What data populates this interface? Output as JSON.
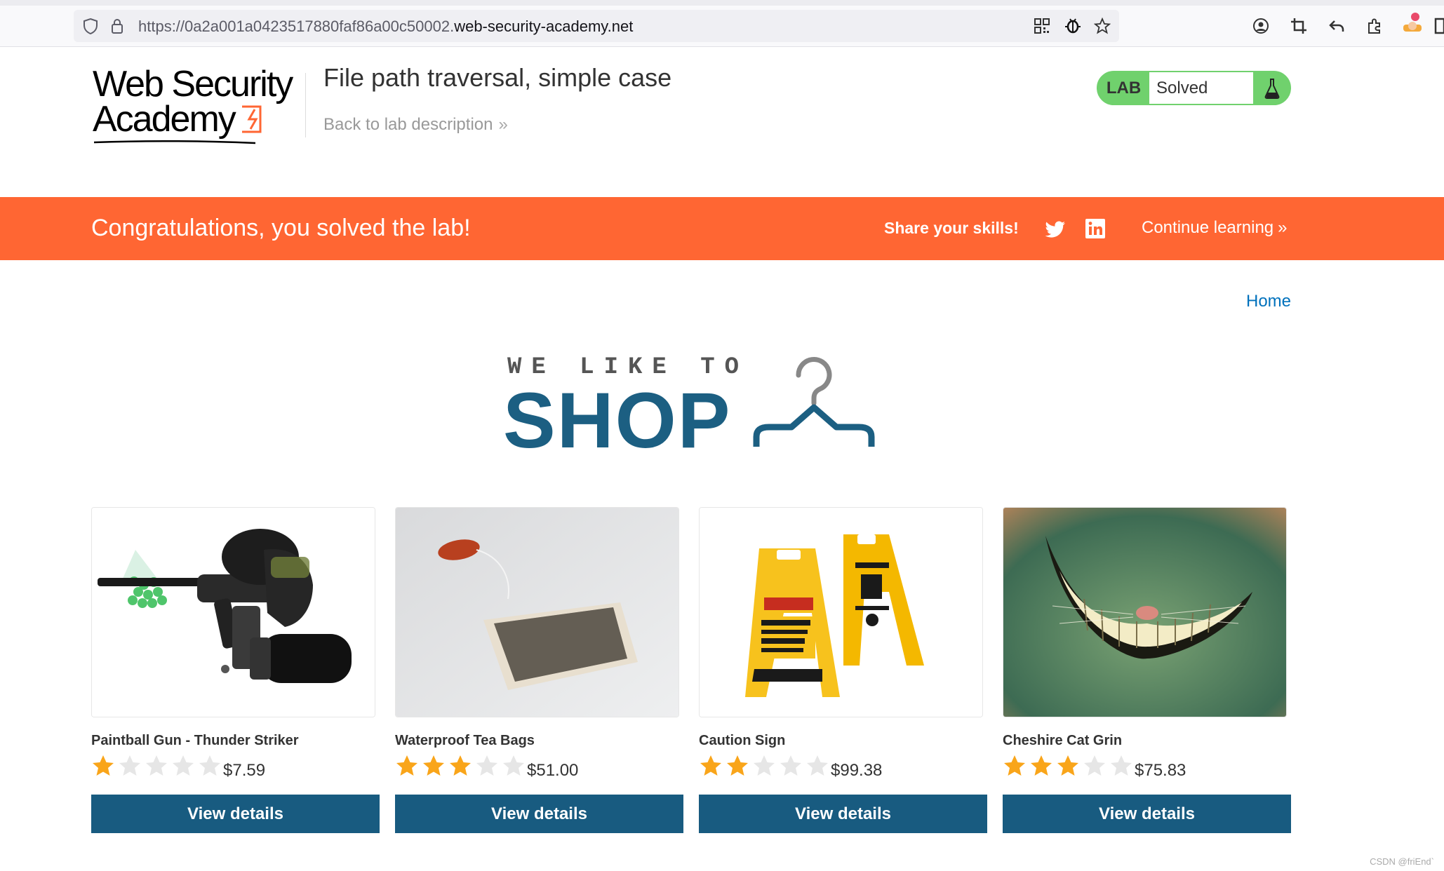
{
  "browser": {
    "url_prefix": "https://0a2a001a0423517880faf86a00c50002.",
    "url_domain": "web-security-academy.net"
  },
  "header": {
    "logo_line1": "Web Security",
    "logo_line2": "Academy",
    "lab_title": "File path traversal, simple case",
    "back_link": "Back to lab description",
    "status_label": "LAB",
    "status_value": "Solved"
  },
  "banner": {
    "message": "Congratulations, you solved the lab!",
    "share_label": "Share your skills!",
    "continue_label": "Continue learning"
  },
  "nav": {
    "home": "Home"
  },
  "hero": {
    "small": "WE LIKE TO",
    "big": "SHOP"
  },
  "products": [
    {
      "name": "Paintball Gun - Thunder Striker",
      "price": "$7.59",
      "rating": 1,
      "button": "View details"
    },
    {
      "name": "Waterproof Tea Bags",
      "price": "$51.00",
      "rating": 3,
      "button": "View details"
    },
    {
      "name": "Caution Sign",
      "price": "$99.38",
      "rating": 2,
      "button": "View details"
    },
    {
      "name": "Cheshire Cat Grin",
      "price": "$75.83",
      "rating": 3,
      "button": "View details"
    }
  ],
  "watermark": "CSDN @friEnd`",
  "colors": {
    "banner": "#ff6633",
    "primary": "#185b80",
    "link": "#0071bc",
    "status_green": "#70d16d",
    "star_on": "#f9a51a",
    "star_off": "#e6e6e6"
  }
}
